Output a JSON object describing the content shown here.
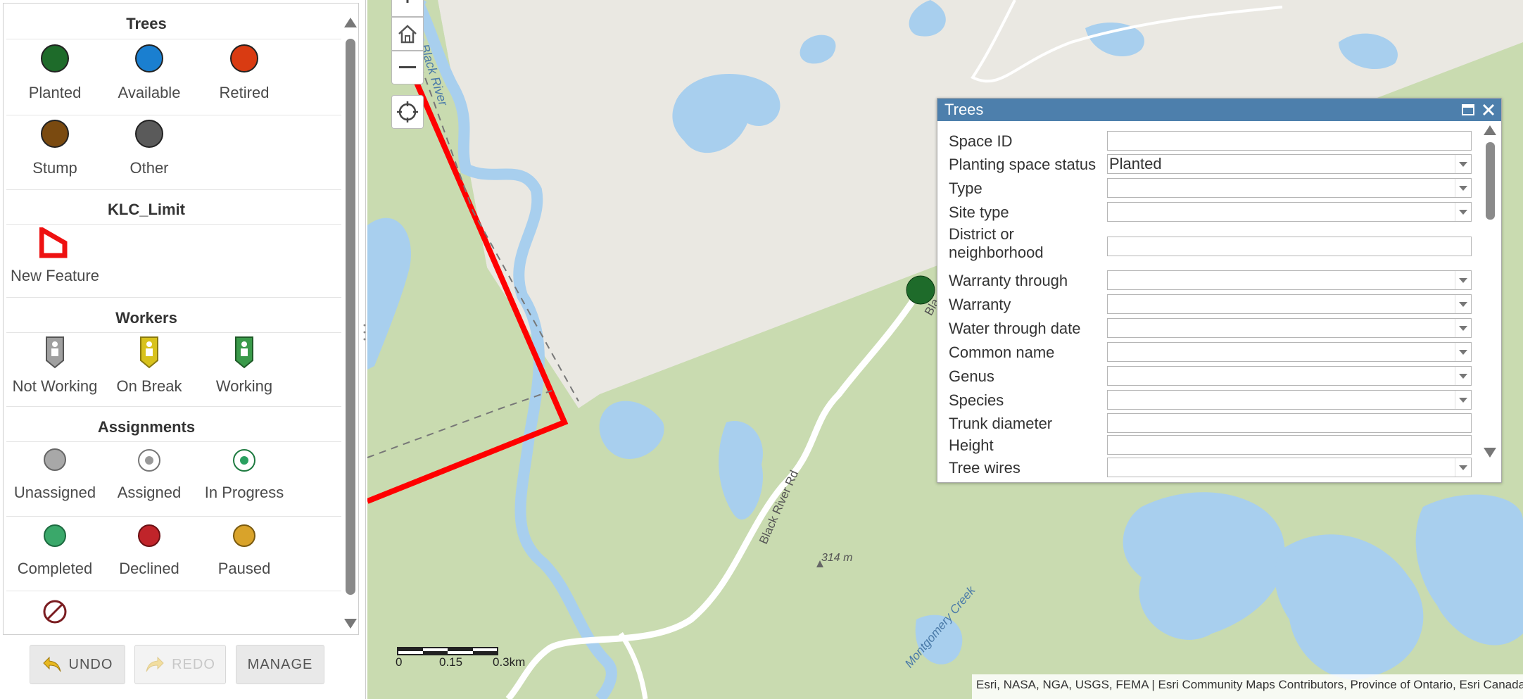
{
  "legend": {
    "trees": {
      "title": "Trees",
      "items": [
        {
          "label": "Planted",
          "color": "#1e6b2a"
        },
        {
          "label": "Available",
          "color": "#1a7fd0"
        },
        {
          "label": "Retired",
          "color": "#d93b12"
        },
        {
          "label": "Stump",
          "color": "#7a4a10"
        },
        {
          "label": "Other",
          "color": "#5a5a5a"
        }
      ]
    },
    "klc_limit": {
      "title": "KLC_Limit",
      "items": [
        {
          "label": "New Feature",
          "color": "#ee1111"
        }
      ]
    },
    "workers": {
      "title": "Workers",
      "items": [
        {
          "label": "Not Working",
          "color": "#a0a0a0"
        },
        {
          "label": "On Break",
          "color": "#d8c21c"
        },
        {
          "label": "Working",
          "color": "#3a9a4a"
        }
      ]
    },
    "assignments": {
      "title": "Assignments",
      "items": [
        {
          "label": "Unassigned",
          "color": "#a8a8a8"
        },
        {
          "label": "Assigned",
          "color": "#ffffff"
        },
        {
          "label": "In Progress",
          "color": "#ffffff"
        },
        {
          "label": "Completed",
          "color": "#3aa86a"
        },
        {
          "label": "Declined",
          "color": "#c0242a"
        },
        {
          "label": "Paused",
          "color": "#d9a32a"
        }
      ]
    }
  },
  "toolbar": {
    "undo_label": "UNDO",
    "redo_label": "REDO",
    "manage_label": "MANAGE"
  },
  "map": {
    "labels": {
      "black_river": "Black River",
      "black_river_rd": "Black River Rd",
      "elevation": "314 m",
      "montgomery_creek": "Montgomery Creek",
      "road_partial": "Bla"
    },
    "scale": {
      "zero": "0",
      "mid": "0.15",
      "end": "0.3km"
    },
    "attribution": "Esri, NASA, NGA, USGS, FEMA | Esri Community Maps Contributors, Province of Ontario, Esri Canada, Esri, T"
  },
  "popup": {
    "title": "Trees",
    "fields": [
      {
        "label": "Space ID",
        "value": "",
        "type": "text"
      },
      {
        "label": "Planting space status",
        "value": "Planted",
        "type": "select"
      },
      {
        "label": "Type",
        "value": "",
        "type": "select"
      },
      {
        "label": "Site type",
        "value": "",
        "type": "select"
      },
      {
        "label": "District or neighborhood",
        "value": "",
        "type": "text"
      },
      {
        "label": "Warranty through",
        "value": "",
        "type": "select"
      },
      {
        "label": "Warranty",
        "value": "",
        "type": "select"
      },
      {
        "label": "Water through date",
        "value": "",
        "type": "select"
      },
      {
        "label": "Common name",
        "value": "",
        "type": "select"
      },
      {
        "label": "Genus",
        "value": "",
        "type": "select"
      },
      {
        "label": "Species",
        "value": "",
        "type": "select"
      },
      {
        "label": "Trunk diameter",
        "value": "",
        "type": "text"
      },
      {
        "label": "Height",
        "value": "",
        "type": "text"
      },
      {
        "label": "Tree wires",
        "value": "",
        "type": "select"
      }
    ]
  }
}
